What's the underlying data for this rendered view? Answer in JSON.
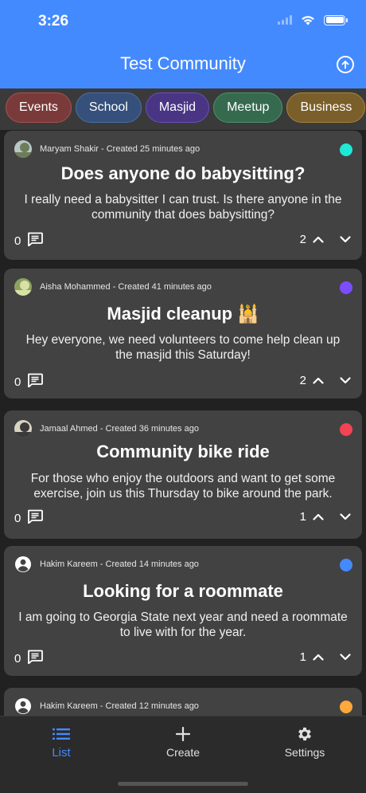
{
  "status_bar": {
    "time": "3:26"
  },
  "header": {
    "title": "Test Community"
  },
  "categories": [
    {
      "label": "Events",
      "bg": "#7a3a3a",
      "border": "#a85252"
    },
    {
      "label": "School",
      "bg": "#35507a",
      "border": "#4a6fa8"
    },
    {
      "label": "Masjid",
      "bg": "#4a3585",
      "border": "#6a4fb8"
    },
    {
      "label": "Meetup",
      "bg": "#356a4f",
      "border": "#4c936e"
    },
    {
      "label": "Business",
      "bg": "#7a5f2a",
      "border": "#a8843c"
    }
  ],
  "posts": [
    {
      "author_line": "Maryam Shakir - Created 25 minutes ago",
      "title": "Does anyone do babysitting?",
      "body": "I really need a babysitter I can trust. Is there anyone in the community that does babysitting?",
      "comments": "0",
      "votes": "2",
      "dot_color": "#1de9d6",
      "avatar": "photo"
    },
    {
      "author_line": "Aisha Mohammed - Created 41 minutes ago",
      "title": "Masjid cleanup 🕌",
      "body": "Hey everyone, we need volunteers to come help clean up the masjid this Saturday!",
      "comments": "0",
      "votes": "2",
      "dot_color": "#7c4dff",
      "avatar": "photo"
    },
    {
      "author_line": "Jamaal Ahmed - Created 36 minutes ago",
      "title": "Community bike ride",
      "body": "For those who enjoy the outdoors and want to get some exercise, join us this Thursday to bike around the park.",
      "comments": "0",
      "votes": "1",
      "dot_color": "#f44352",
      "avatar": "photo"
    },
    {
      "author_line": "Hakim Kareem - Created 14 minutes ago",
      "title": "Looking for a roommate",
      "body": "I am going to Georgia State next year and need a roommate to live with for the year.",
      "comments": "0",
      "votes": "1",
      "dot_color": "#448aff",
      "avatar": "default"
    },
    {
      "author_line": "Hakim Kareem - Created 12 minutes ago",
      "dot_color": "#ffa93a",
      "avatar": "default"
    }
  ],
  "tabs": [
    {
      "label": "List",
      "icon": "list-icon",
      "active": true
    },
    {
      "label": "Create",
      "icon": "plus-icon",
      "active": false
    },
    {
      "label": "Settings",
      "icon": "gear-icon",
      "active": false
    }
  ],
  "colors": {
    "accent": "#448aff",
    "active_tab": "#448aff"
  }
}
